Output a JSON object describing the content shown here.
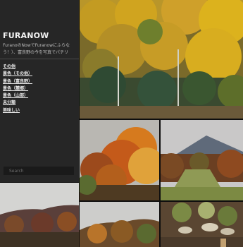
{
  "site": {
    "title": "FURANOW",
    "tagline": "FuranoのNowでFuranowにふらな\nう！）、富良野の今を写真でパチリ"
  },
  "nav": {
    "items": [
      {
        "label": "その他"
      },
      {
        "label": "景色（その他）"
      },
      {
        "label": "景色（富良野）"
      },
      {
        "label": "景色（麓郷）"
      },
      {
        "label": "景色（山部）"
      },
      {
        "label": "未分類"
      },
      {
        "label": "美味しい"
      }
    ]
  },
  "search": {
    "placeholder": "Search"
  },
  "colors": {
    "sidebar": "#262626",
    "background": "#0e0e0e",
    "text": "#f2f2f2"
  }
}
